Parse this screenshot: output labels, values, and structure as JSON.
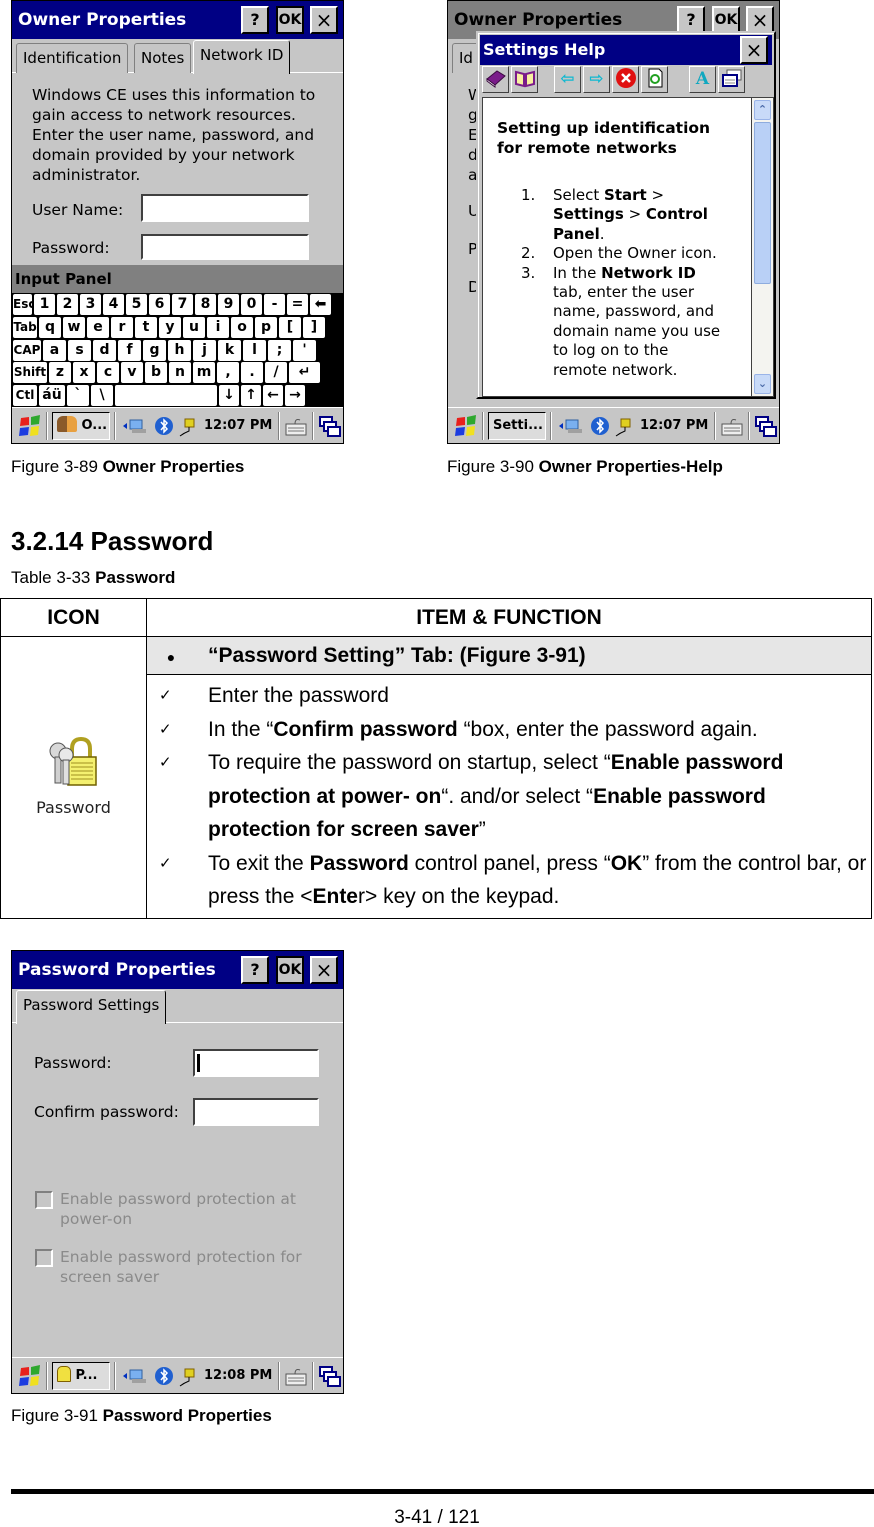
{
  "figure_89": {
    "window_title": "Owner Properties",
    "title_buttons": {
      "help": "?",
      "ok": "OK",
      "close": "×"
    },
    "tabs": [
      "Identification",
      "Notes",
      "Network ID"
    ],
    "active_tab": "Network ID",
    "description_lines": [
      "Windows CE uses this information to",
      "gain access to network resources.",
      "Enter the user name, password, and",
      "domain provided by your network",
      "administrator."
    ],
    "user_name_label": "User Name:",
    "user_name_value": "",
    "password_label": "Password:",
    "password_value": "",
    "input_panel_title": "Input Panel",
    "keyboard_rows": [
      [
        "Esc",
        "1",
        "2",
        "3",
        "4",
        "5",
        "6",
        "7",
        "8",
        "9",
        "0",
        "-",
        "=",
        "⬅"
      ],
      [
        "Tab",
        "q",
        "w",
        "e",
        "r",
        "t",
        "y",
        "u",
        "i",
        "o",
        "p",
        "[",
        "]"
      ],
      [
        "CAP",
        "a",
        "s",
        "d",
        "f",
        "g",
        "h",
        "j",
        "k",
        "l",
        ";",
        "'"
      ],
      [
        "Shift",
        "z",
        "x",
        "c",
        "v",
        "b",
        "n",
        "m",
        ",",
        ".",
        "/",
        "↵"
      ],
      [
        "Ctl",
        "áü",
        "`",
        "\\",
        " ",
        "↓",
        "↑",
        "←",
        "→"
      ]
    ],
    "taskbar": {
      "task_label": "O...",
      "clock": "12:07 PM"
    },
    "caption_prefix": "Figure 3-89",
    "caption_title": "Owner Properties"
  },
  "figure_90": {
    "window_title": "Owner Properties",
    "title_buttons": {
      "help": "?",
      "ok": "OK",
      "close": "×"
    },
    "background_tab_fragment": "Id",
    "background_text_fragments": [
      "W",
      "g",
      "E",
      "d",
      "a",
      "U",
      "P",
      "D"
    ],
    "help_title": "Settings Help",
    "help_close": "×",
    "help_toolbar": [
      "contents-book",
      "open-book",
      "back-arrow",
      "forward-arrow",
      "stop",
      "refresh",
      "font-size",
      "window-options"
    ],
    "help_heading": "Setting up identification for remote networks",
    "help_steps": [
      {
        "num": "1.",
        "parts": [
          {
            "t": "Select "
          },
          {
            "b": "Start"
          },
          {
            "t": " > "
          },
          {
            "b": "Settings"
          },
          {
            "t": " > "
          },
          {
            "b": "Control Panel"
          },
          {
            "t": "."
          }
        ]
      },
      {
        "num": "2.",
        "parts": [
          {
            "t": "Open the Owner icon."
          }
        ]
      },
      {
        "num": "3.",
        "parts": [
          {
            "t": "In the "
          },
          {
            "b": "Network ID"
          },
          {
            "t": " tab, enter the user name, password, and domain name you use to log on to the remote network."
          }
        ]
      }
    ],
    "taskbar": {
      "task_label": "Setti...",
      "clock": "12:07 PM"
    },
    "caption_prefix": "Figure 3-90",
    "caption_title": "Owner Properties-Help"
  },
  "section": {
    "heading": "3.2.14 Password",
    "table_caption_prefix": "Table 3-33",
    "table_caption_title": "Password"
  },
  "table": {
    "headers": [
      "ICON",
      "ITEM & FUNCTION"
    ],
    "icon_label": "Password",
    "section_bullet": "●",
    "section_title": "“Password Setting” Tab: (Figure 3-91)",
    "check_mark": "✓",
    "items": [
      [
        {
          "t": "Enter the password"
        }
      ],
      [
        {
          "t": "In the “"
        },
        {
          "b": "Confirm password"
        },
        {
          "t": " “box, enter the password again."
        }
      ],
      [
        {
          "t": "To require the password on startup, select “"
        },
        {
          "b": "Enable password protection at power- on"
        },
        {
          "t": "“. and/or select “"
        },
        {
          "b": "Enable password protection for screen saver"
        },
        {
          "t": "”"
        }
      ],
      [
        {
          "t": "To exit the "
        },
        {
          "b": "Password"
        },
        {
          "t": " control panel, press “"
        },
        {
          "b": "OK"
        },
        {
          "t": "” from the control bar, or press the <"
        },
        {
          "b": "Ente"
        },
        {
          "t": "r> key on the keypad."
        }
      ]
    ]
  },
  "figure_91": {
    "window_title": "Password Properties",
    "title_buttons": {
      "help": "?",
      "ok": "OK",
      "close": "×"
    },
    "tab": "Password Settings",
    "password_label": "Password:",
    "password_value": "",
    "confirm_label": "Confirm password:",
    "confirm_value": "",
    "checkbox_power_on": {
      "label_line1": "Enable password protection at",
      "label_line2": "power-on",
      "checked": false,
      "enabled": false
    },
    "checkbox_screensaver": {
      "label_line1": "Enable password protection for",
      "label_line2": "screen saver",
      "checked": false,
      "enabled": false
    },
    "taskbar": {
      "task_label": "P...",
      "clock": "12:08 PM"
    },
    "caption_prefix": "Figure 3-91",
    "caption_title": "Password Properties"
  },
  "footer": {
    "page_number": "3-41 / 121"
  }
}
